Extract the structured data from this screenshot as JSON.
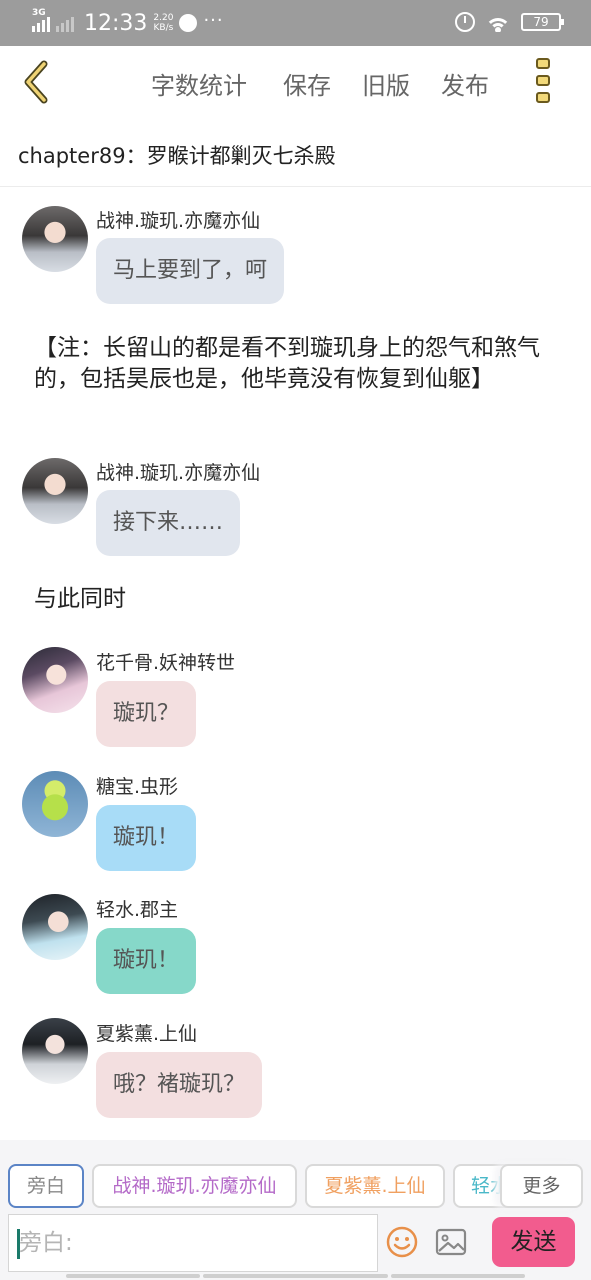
{
  "status_bar": {
    "network": "3G",
    "time": "12:33",
    "speed_value": "2.20",
    "speed_unit": "KB/s",
    "overflow": "···",
    "battery": "79"
  },
  "toolbar": {
    "word_count": "字数统计",
    "save": "保存",
    "old_version": "旧版",
    "publish": "发布"
  },
  "chapter_title": "chapter89：罗睺计都剿灭七杀殿",
  "messages": [
    {
      "type": "chat",
      "sender": "战神.璇玑.亦魔亦仙",
      "text": "马上要到了，呵",
      "bubble_color": "#e1e6ee",
      "avatar_icon": "avatar-woman-grey-robe"
    },
    {
      "type": "narration",
      "text": "【注：长留山的都是看不到璇玑身上的怨气和煞气的，包括昊辰也是，他毕竟没有恢复到仙躯】"
    },
    {
      "type": "chat",
      "sender": "战神.璇玑.亦魔亦仙",
      "text": "接下来……",
      "bubble_color": "#e1e6ee",
      "avatar_icon": "avatar-woman-grey-robe"
    },
    {
      "type": "narration",
      "text": "与此同时"
    },
    {
      "type": "chat",
      "sender": "花千骨.妖神转世",
      "text": "璇玑？",
      "bubble_color": "#f3dfe0",
      "avatar_icon": "avatar-woman-pink-robe"
    },
    {
      "type": "chat",
      "sender": "糖宝.虫形",
      "text": "璇玑！",
      "bubble_color": "#a8dcf7",
      "avatar_icon": "avatar-green-caterpillar"
    },
    {
      "type": "chat",
      "sender": "轻水.郡主",
      "text": "璇玑！",
      "bubble_color": "#86d8c9",
      "avatar_icon": "avatar-woman-blue-robe"
    },
    {
      "type": "chat",
      "sender": "夏紫薰.上仙",
      "text": "哦？褚璇玑？",
      "bubble_color": "#f3dfe0",
      "avatar_icon": "avatar-woman-white-robe"
    }
  ],
  "role_chips": [
    {
      "label": "旁白",
      "color": "#888888"
    },
    {
      "label": "战神.璇玑.亦魔亦仙",
      "color": "#b46ac8"
    },
    {
      "label": "夏紫薰.上仙",
      "color": "#f0a060"
    },
    {
      "label": "轻水",
      "color": "#4ab8c8"
    }
  ],
  "more_label": "更多",
  "input": {
    "placeholder": "旁白:",
    "value": ""
  },
  "send_label": "发送",
  "icons": {
    "back": "chevron-left-icon",
    "menu": "vertical-dots-icon",
    "emoji": "smiley-icon",
    "image": "image-icon"
  }
}
